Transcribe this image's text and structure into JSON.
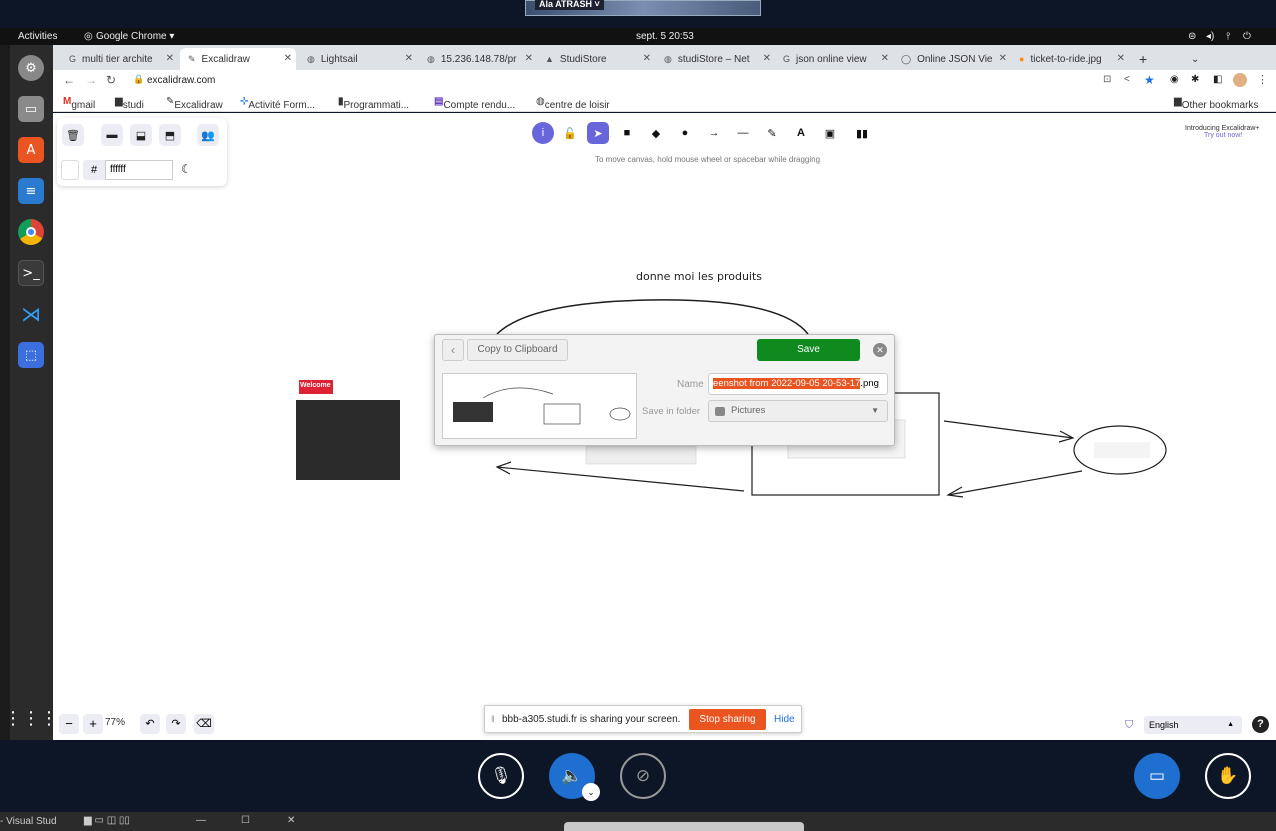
{
  "system": {
    "activities": "Activities",
    "chrome_menu": "Google Chrome ▾",
    "datetime": "sept. 5  20:53",
    "presenter": "Ala ATRASH ˅"
  },
  "browser": {
    "tabs": [
      {
        "label": "multi tier archite",
        "icon": "google-icon"
      },
      {
        "label": "Excalidraw",
        "icon": "excalidraw-icon",
        "active": true
      },
      {
        "label": "Lightsail",
        "icon": "globe-icon"
      },
      {
        "label": "15.236.148.78/pr",
        "icon": "globe-icon"
      },
      {
        "label": "StudiStore",
        "icon": "angular-icon"
      },
      {
        "label": "studiStore – Net",
        "icon": "globe-icon"
      },
      {
        "label": "json online view",
        "icon": "google-icon"
      },
      {
        "label": "Online JSON Vie",
        "icon": "json-icon"
      },
      {
        "label": "ticket-to-ride.jpg",
        "icon": "image-icon"
      }
    ],
    "url": "excalidraw.com",
    "bookmarks": [
      "gmail",
      "studi",
      "Excalidraw",
      "Activité Form...",
      "Programmati...",
      "Compte rendu...",
      "centre de loisir"
    ],
    "other_bookmarks": "Other bookmarks"
  },
  "excalidraw": {
    "color_hash": "#",
    "bg_color": "ffffff",
    "hint": "To move canvas, hold mouse wheel or spacebar while dragging",
    "promo_line1": "Introducing Excalidraw+",
    "promo_line2": "Try out now!",
    "zoom": "77%",
    "language": "English",
    "help": "?",
    "tools": [
      "lock",
      "select",
      "rectangle",
      "diamond",
      "ellipse",
      "arrow",
      "line",
      "draw",
      "text",
      "image",
      "library"
    ]
  },
  "drawing": {
    "label": "donne moi les produits",
    "thumb_text": "Welcome"
  },
  "dialog": {
    "copy_label": "Copy to Clipboard",
    "save_label": "Save",
    "name_label": "Name",
    "filename_selected": "eenshot from 2022-09-05 20-53-17",
    "filename_ext": ".png",
    "folder_label": "Save in folder",
    "folder_value": "Pictures"
  },
  "sharing": {
    "message": "bbb-a305.studi.fr is sharing your screen.",
    "stop_label": "Stop sharing",
    "hide_label": "Hide"
  },
  "taskbar": {
    "app_label": "- Visual Stud"
  }
}
